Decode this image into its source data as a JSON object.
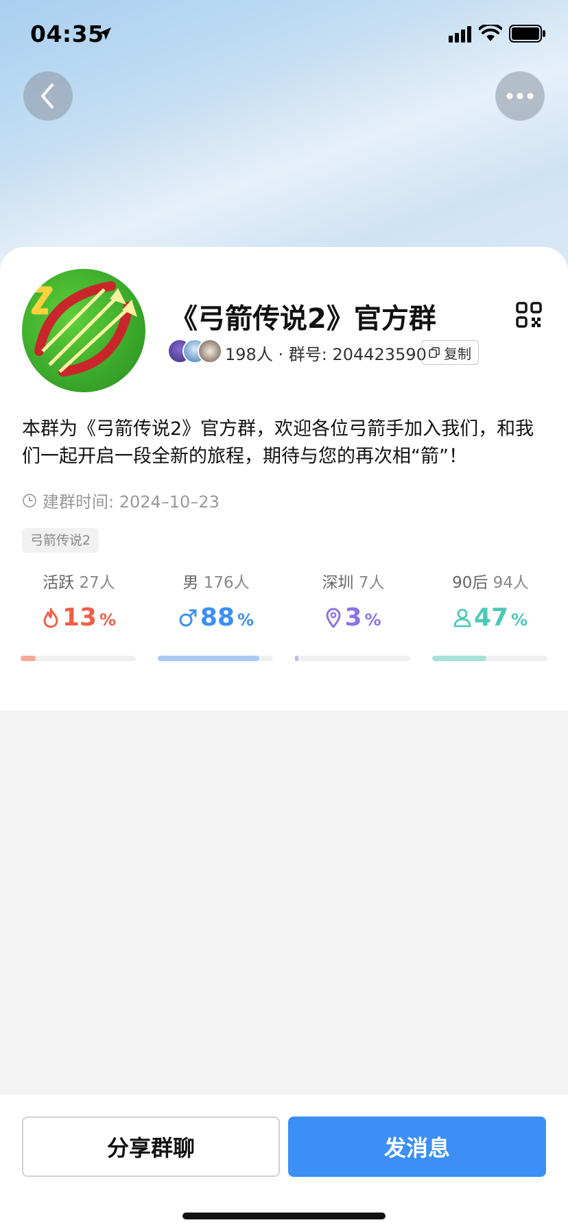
{
  "status": {
    "time": "04:35"
  },
  "group": {
    "name": "《弓箭传说2》官方群",
    "member_count": "198人",
    "separator": "·",
    "group_no_label": "群号: 204423590",
    "copy_label": "复制",
    "description": "本群为《弓箭传说2》官方群，欢迎各位弓箭手加入我们，和我们一起开启一段全新的旅程，期待与您的再次相“箭”！",
    "created_label": "建群时间: 2024–10–23",
    "tag": "弓箭传说2"
  },
  "stats": [
    {
      "label": "活跃",
      "count": "27人",
      "value": "13",
      "unit": "%",
      "fraction": 0.13,
      "color": "#ee6048",
      "bar_color": "#f5a89b",
      "icon": "flame-icon"
    },
    {
      "label": "男",
      "count": "176人",
      "value": "88",
      "unit": "%",
      "fraction": 0.88,
      "color": "#3b8ff5",
      "bar_color": "#a9c9f8",
      "icon": "male-icon"
    },
    {
      "label": "深圳",
      "count": "7人",
      "value": "3",
      "unit": "%",
      "fraction": 0.03,
      "color": "#8b72e8",
      "bar_color": "#c2b5f2",
      "icon": "location-icon"
    },
    {
      "label": "90后",
      "count": "94人",
      "value": "47",
      "unit": "%",
      "fraction": 0.47,
      "color": "#4cc8b8",
      "bar_color": "#a5e3da",
      "icon": "person-icon"
    }
  ],
  "actions": {
    "share_label": "分享群聊",
    "send_label": "发消息"
  },
  "colors": {
    "primary": "#3b8ff5",
    "card_bg": "#ffffff",
    "page_bg": "#f4f4f4"
  }
}
